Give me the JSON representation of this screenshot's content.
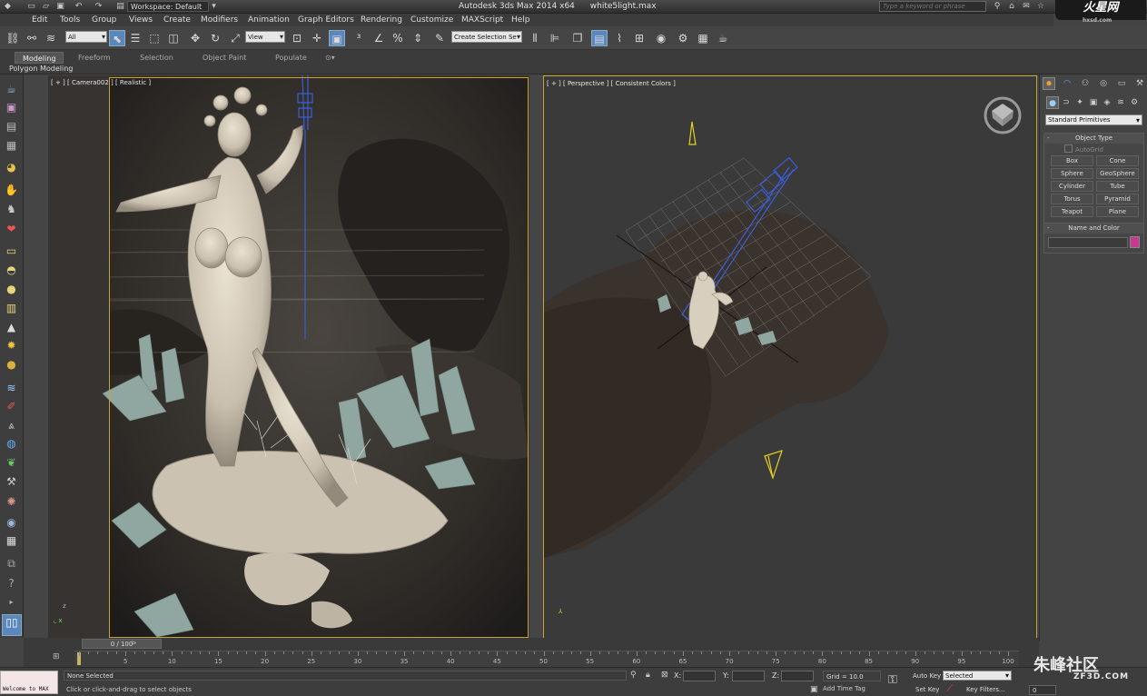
{
  "titlebar": {
    "workspace": "Workspace: Default",
    "app_title": "Autodesk 3ds Max  2014 x64",
    "file_name": "white5light.max",
    "search_placeholder": "Type a keyword or phrase",
    "logo": "火星网",
    "logo_url": "hxsd.com"
  },
  "menu": [
    "Edit",
    "Tools",
    "Group",
    "Views",
    "Create",
    "Modifiers",
    "Animation",
    "Graph Editors",
    "Rendering",
    "Customize",
    "MAXScript",
    "Help"
  ],
  "toolbar": {
    "selection_filter": "All",
    "reference_coord": "View",
    "named_selection": "Create Selection Se"
  },
  "ribbon": {
    "tabs": [
      "Modeling",
      "Freeform",
      "Selection",
      "Object Paint",
      "Populate"
    ],
    "active_tab": "Modeling",
    "sub_label": "Polygon Modeling"
  },
  "viewports": {
    "left_label": "[ + ] [ Camera002 ] [ Realistic ]",
    "right_label": "[ + ] [ Perspective ] [ Consistent Colors ]"
  },
  "command_panel": {
    "category": "Standard Primitives",
    "object_type_title": "Object Type",
    "autogrid": "AutoGrid",
    "buttons": [
      "Box",
      "Cone",
      "Sphere",
      "GeoSphere",
      "Cylinder",
      "Tube",
      "Torus",
      "Pyramid",
      "Teapot",
      "Plane"
    ],
    "name_color_title": "Name and Color",
    "object_color": "#c53a8e"
  },
  "timeline": {
    "slider_label": "0 / 100",
    "ticks": [
      5,
      10,
      15,
      20,
      25,
      30,
      35,
      40,
      45,
      50,
      55,
      60,
      65,
      70,
      75,
      80,
      85,
      90,
      95,
      100
    ]
  },
  "status": {
    "maxscript": "Welcome to MAX",
    "selection": "None Selected",
    "prompt": "Click or click-and-drag to select objects",
    "x_label": "X:",
    "y_label": "Y:",
    "z_label": "Z:",
    "grid": "Grid = 10.0",
    "add_time_tag": "Add Time Tag",
    "auto_key": "Auto Key",
    "set_key": "Set Key",
    "auto_key_value": "Selected",
    "key_filters": "Key Filters...",
    "frame": "0"
  },
  "watermark": {
    "text": "朱峰社区",
    "url": "ZF3D.COM"
  }
}
